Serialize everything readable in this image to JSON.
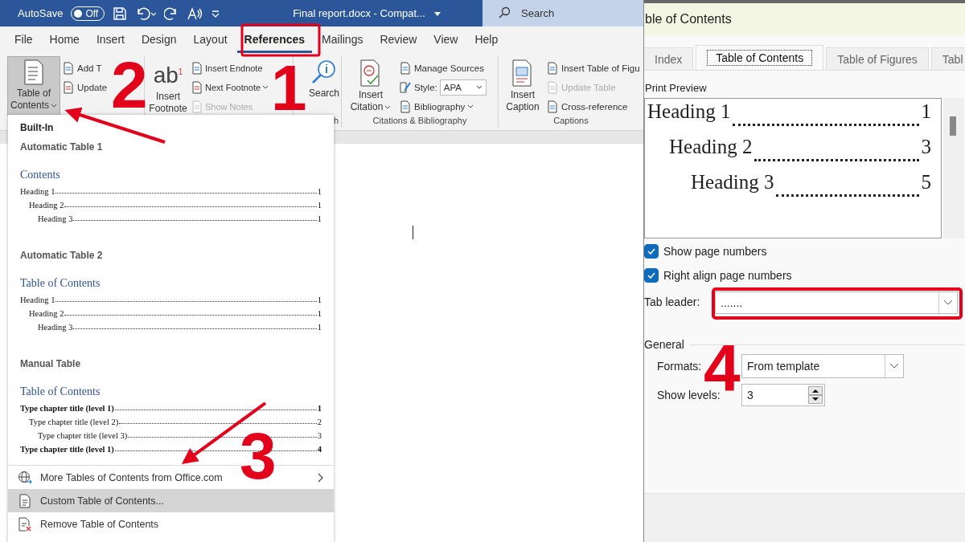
{
  "titlebar": {
    "autosave_label": "AutoSave",
    "autosave": {
      "label": "Off",
      "on": false
    },
    "document_title": "Final report.docx  -  Compat...",
    "search_placeholder": "Search"
  },
  "ribbon_tabs": [
    {
      "label": "File",
      "selected": false
    },
    {
      "label": "Home",
      "selected": false
    },
    {
      "label": "Insert",
      "selected": false
    },
    {
      "label": "Design",
      "selected": false
    },
    {
      "label": "Layout",
      "selected": false
    },
    {
      "label": "References",
      "selected": true
    },
    {
      "label": "Mailings",
      "selected": false
    },
    {
      "label": "Review",
      "selected": false
    },
    {
      "label": "View",
      "selected": false
    },
    {
      "label": "Help",
      "selected": false
    }
  ],
  "ribbon": {
    "groups": [
      {
        "big": {
          "label": "Table of Contents",
          "pressed": true,
          "dropdown": true
        },
        "small": [
          {
            "label": "Add T",
            "disabled": false
          },
          {
            "label": "Update",
            "disabled": false
          }
        ]
      },
      {
        "big": {
          "label": "Insert Footnote",
          "icon_text": "ab",
          "icon_sup": "1",
          "pressed": false
        },
        "small": [
          {
            "label": "Insert Endnote",
            "disabled": false
          },
          {
            "label": "Next Footnote",
            "disabled": false,
            "dropdown": true
          },
          {
            "label": "Show Notes",
            "disabled": true
          }
        ]
      },
      {
        "label": "h",
        "big": {
          "label": "Search",
          "pressed": false
        }
      },
      {
        "label": "Citations & Bibliography",
        "big": {
          "label": "Insert Citation",
          "pressed": false,
          "dropdown": true
        },
        "small": [
          {
            "label": "Manage Sources",
            "disabled": false
          },
          {
            "kind": "select",
            "label": "Style:",
            "value": "APA"
          },
          {
            "label": "Bibliography",
            "disabled": false,
            "dropdown": true
          }
        ]
      },
      {
        "label": "Captions",
        "big": {
          "label": "Insert Caption",
          "pressed": false
        },
        "small": [
          {
            "label": "Insert Table of Figu",
            "disabled": false
          },
          {
            "label": "Update Table",
            "disabled": true
          },
          {
            "label": "Cross-reference",
            "disabled": false
          }
        ]
      }
    ]
  },
  "menu": {
    "header": "Built-In",
    "galleries": [
      {
        "name": "Automatic Table 1",
        "heading": "Contents",
        "entries": [
          {
            "text": "Heading 1",
            "page": "1",
            "children": [
              {
                "text": "Heading 2",
                "page": "1",
                "children": [
                  {
                    "text": "Heading 3",
                    "page": "1"
                  }
                ]
              }
            ]
          }
        ]
      },
      {
        "name": "Automatic Table 2",
        "heading": "Table of Contents",
        "entries": [
          {
            "text": "Heading 1",
            "page": "1",
            "children": [
              {
                "text": "Heading 2",
                "page": "1",
                "children": [
                  {
                    "text": "Heading 3",
                    "page": "1"
                  }
                ]
              }
            ]
          }
        ]
      },
      {
        "name": "Manual Table",
        "heading": "Table of Contents",
        "entries": [
          {
            "text": "Type chapter title (level 1)",
            "page": "1",
            "children": [
              {
                "text": "Type chapter title (level 2)",
                "page": "2",
                "children": [
                  {
                    "text": "Type chapter title (level 3)",
                    "page": "3"
                  }
                ]
              }
            ]
          },
          {
            "text": "Type chapter title (level 1)",
            "page": "4"
          }
        ]
      }
    ],
    "items": [
      {
        "label": "More Tables of Contents from Office.com",
        "submenu": true,
        "selected": false
      },
      {
        "label": "Custom Table of Contents...",
        "submenu": false,
        "selected": true
      },
      {
        "label": "Remove Table of Contents",
        "submenu": false,
        "selected": false
      }
    ]
  },
  "dialog": {
    "title": "ble of Contents",
    "tabs": [
      {
        "label": "Index",
        "selected": false
      },
      {
        "label": "Table of Contents",
        "selected": true
      },
      {
        "label": "Table of Figures",
        "selected": false
      },
      {
        "label": "Tabl",
        "selected": false
      }
    ],
    "preview_label": "Print Preview",
    "preview": [
      {
        "text": "Heading 1",
        "page": "1",
        "children": [
          {
            "text": "Heading 2",
            "page": "3",
            "children": [
              {
                "text": "Heading 3",
                "page": "5"
              }
            ]
          }
        ]
      }
    ],
    "options": [
      {
        "label": "Show page numbers",
        "checked": true
      },
      {
        "label": "Right align page numbers",
        "checked": true
      }
    ],
    "tab_leader": {
      "label": "Tab leader:",
      "value": "......."
    },
    "general": {
      "title": "General",
      "formats": {
        "label": "Formats:",
        "value": "From template"
      },
      "show_levels": {
        "label": "Show levels:",
        "value": "3"
      }
    }
  },
  "annotations": [
    {
      "text": "1"
    },
    {
      "text": "2"
    },
    {
      "text": "3"
    },
    {
      "text": "4"
    }
  ]
}
